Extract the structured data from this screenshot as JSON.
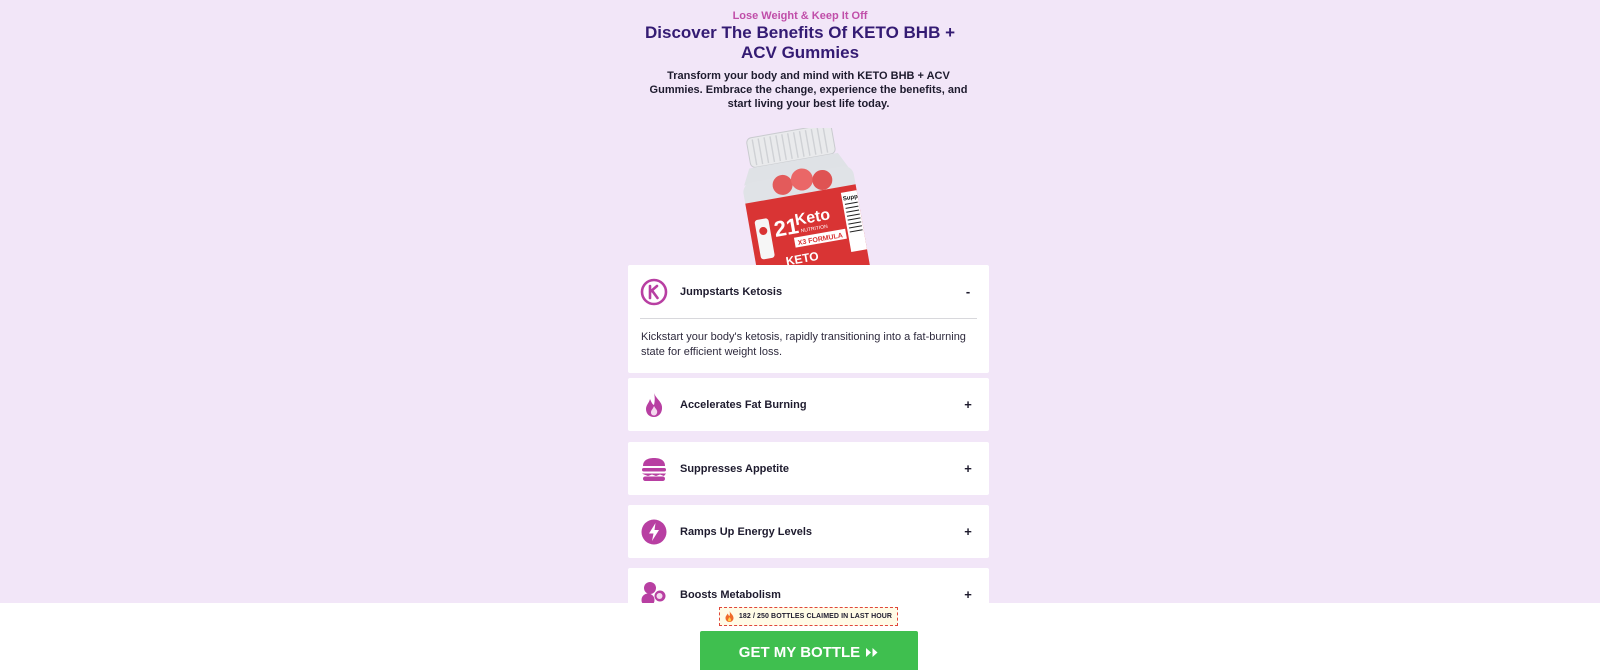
{
  "hero": {
    "eyebrow": "Lose Weight & Keep It Off",
    "headline": "Discover The Benefits Of KETO BHB + ACV Gummies",
    "subtext": "Transform your body and mind with KETO BHB + ACV Gummies. Embrace the change, experience the benefits, and start living your best life today."
  },
  "product": {
    "brand_number": "21",
    "brand_name": "Keto",
    "brand_sub": "NUTRITION",
    "formula": "X3 FORMULA",
    "label_bottom": "KETO",
    "panel": "Supp"
  },
  "colors": {
    "background": "#f2e6f8",
    "accent_magenta": "#b83fa2",
    "headline_purple": "#341b73",
    "eyebrow_pink": "#c04ea9",
    "cta_green": "#3fbf4f"
  },
  "benefits": [
    {
      "icon": "k-circle-icon",
      "title": "Jumpstarts Ketosis",
      "toggle": "-",
      "expanded": true,
      "body": "Kickstart your body's ketosis, rapidly transitioning into a fat-burning state for efficient weight loss."
    },
    {
      "icon": "flame-icon",
      "title": "Accelerates Fat Burning",
      "toggle": "+",
      "expanded": false
    },
    {
      "icon": "burger-icon",
      "title": "Suppresses Appetite",
      "toggle": "+",
      "expanded": false
    },
    {
      "icon": "lightning-icon",
      "title": "Ramps Up Energy Levels",
      "toggle": "+",
      "expanded": false
    },
    {
      "icon": "molecule-icon",
      "title": "Boosts Metabolism",
      "toggle": "+",
      "expanded": false
    }
  ],
  "sticky": {
    "claimed_text": "182 / 250 BOTTLES CLAIMED IN LAST HOUR",
    "claimed": 182,
    "total": 250,
    "cta_label": "GET MY BOTTLE"
  }
}
